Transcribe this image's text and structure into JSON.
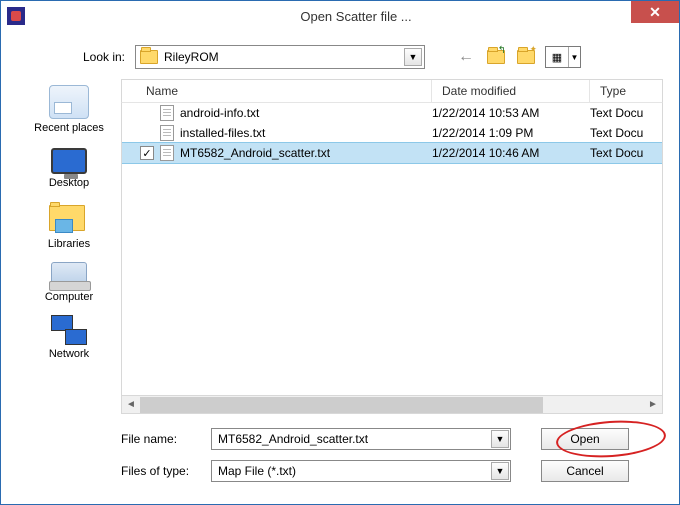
{
  "window": {
    "title": "Open Scatter file ..."
  },
  "lookin": {
    "label": "Look in:",
    "value": "RileyROM"
  },
  "columns": {
    "name": "Name",
    "date": "Date modified",
    "type": "Type"
  },
  "files": [
    {
      "name": "android-info.txt",
      "date": "1/22/2014 10:53 AM",
      "type": "Text Docu",
      "selected": false
    },
    {
      "name": "installed-files.txt",
      "date": "1/22/2014 1:09 PM",
      "type": "Text Docu",
      "selected": false
    },
    {
      "name": "MT6582_Android_scatter.txt",
      "date": "1/22/2014 10:46 AM",
      "type": "Text Docu",
      "selected": true
    }
  ],
  "sidebar": {
    "recent": "Recent places",
    "desktop": "Desktop",
    "libraries": "Libraries",
    "computer": "Computer",
    "network": "Network"
  },
  "filename": {
    "label": "File name:",
    "value": "MT6582_Android_scatter.txt"
  },
  "filetype": {
    "label": "Files of type:",
    "value": "Map File (*.txt)"
  },
  "buttons": {
    "open": "Open",
    "cancel": "Cancel"
  }
}
